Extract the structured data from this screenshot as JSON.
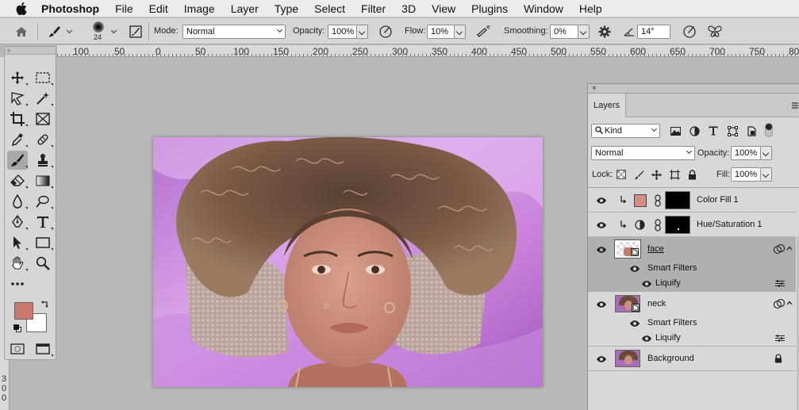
{
  "menu": {
    "app": "Photoshop",
    "items": [
      "File",
      "Edit",
      "Image",
      "Layer",
      "Type",
      "Select",
      "Filter",
      "3D",
      "View",
      "Plugins",
      "Window",
      "Help"
    ]
  },
  "options": {
    "brush_size": "24",
    "mode_label": "Mode:",
    "mode_value": "Normal",
    "opacity_label": "Opacity:",
    "opacity_value": "100%",
    "flow_label": "Flow:",
    "flow_value": "10%",
    "smoothing_label": "Smoothing:",
    "smoothing_value": "0%",
    "angle_value": "14°"
  },
  "ruler": {
    "top_labels": [
      "100",
      "50",
      "0",
      "50",
      "100",
      "150",
      "200",
      "250",
      "300",
      "350",
      "400",
      "450",
      "500",
      "550",
      "600",
      "650",
      "700",
      "750",
      "80"
    ],
    "left_labels": [
      "3",
      "0",
      "0"
    ]
  },
  "toolbar": {
    "header": "«"
  },
  "colors": {
    "foreground": "#c97a6c",
    "background": "#ffffff",
    "color_fill_swatch": "#d48f84"
  },
  "layers_panel": {
    "close": "×",
    "tab": "Layers",
    "filter_kind": "Kind",
    "blend_mode": "Normal",
    "opacity_label": "Opacity:",
    "opacity_value": "100%",
    "lock_label": "Lock:",
    "fill_label": "Fill:",
    "fill_value": "100%",
    "layers": [
      {
        "name": "Color Fill 1"
      },
      {
        "name": "Hue/Saturation 1"
      },
      {
        "name": "face",
        "smart_filters": "Smart Filters",
        "filter": "Liquify"
      },
      {
        "name": "neck",
        "smart_filters": "Smart Filters",
        "filter": "Liquify"
      },
      {
        "name": "Background"
      }
    ]
  }
}
